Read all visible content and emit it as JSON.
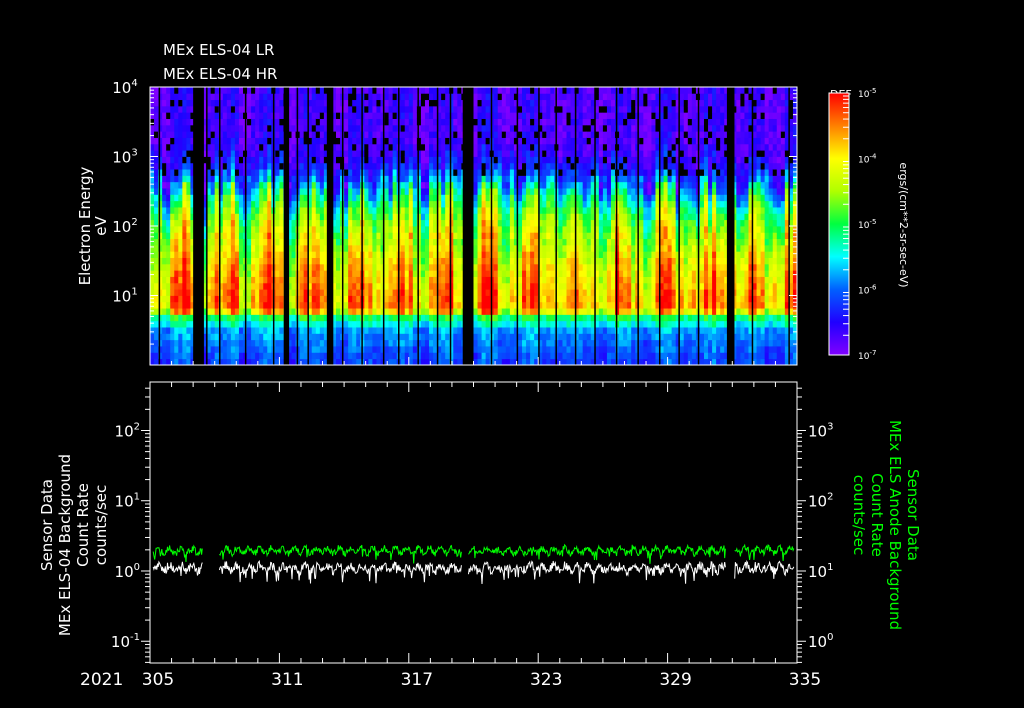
{
  "chart_data": [
    {
      "type": "heatmap",
      "title_lines": [
        "MEx ELS-04 LR",
        "MEx ELS-04 HR"
      ],
      "ylabel": [
        "Electron Energy",
        "eV"
      ],
      "yscale": "log",
      "ylim": [
        1,
        10000
      ],
      "yticks": [
        {
          "v": 10,
          "base": "10",
          "exp": "1"
        },
        {
          "v": 100,
          "base": "10",
          "exp": "2"
        },
        {
          "v": 1000,
          "base": "10",
          "exp": "3"
        },
        {
          "v": 10000,
          "base": "10",
          "exp": "4"
        }
      ],
      "xlim": [
        305,
        335
      ],
      "colorbar": {
        "label": "DEF",
        "units": "ergs/(cm**2-sr-sec-eV)",
        "log_range": [
          -7,
          -5
        ],
        "ticks": [
          {
            "base": "10",
            "exp": "-5",
            "v": -5
          },
          {
            "base": "10",
            "exp": "-4",
            "v": -4
          },
          {
            "base": "10",
            "exp": "-5",
            "v": -3
          },
          {
            "base": "10",
            "exp": "-6",
            "v": -2
          },
          {
            "base": "10",
            "exp": "-7",
            "v": -1
          }
        ],
        "colors": [
          "#8000ff",
          "#2000ff",
          "#0060ff",
          "#00ffff",
          "#00ff40",
          "#b0ff00",
          "#ffff00",
          "#ff8000",
          "#ff0000"
        ]
      },
      "typical_profile": {
        "log_energy_eV": [
          0.0,
          0.5,
          0.7,
          0.8,
          1.0,
          1.5,
          2.0,
          2.3,
          2.6,
          3.0,
          3.5,
          4.0
        ],
        "log_def": [
          -6.6,
          -6.4,
          -6.0,
          -5.3,
          -5.3,
          -5.5,
          -5.8,
          -6.1,
          -6.6,
          -6.85,
          -6.85,
          -6.85
        ]
      },
      "data_gaps_day": [
        [
          307.0,
          307.5
        ],
        [
          311.2,
          311.45
        ],
        [
          313.2,
          313.5
        ],
        [
          319.5,
          320.0
        ],
        [
          331.75,
          332.1
        ]
      ],
      "thin_gaps_day": [
        305.4,
        307.6,
        308.2,
        309.4,
        310.7,
        311.8,
        312.3,
        313.9,
        314.8,
        315.8,
        316.5,
        317.4,
        318.3,
        318.9,
        320.8,
        322.0,
        323.0,
        323.8,
        324.7,
        325.6,
        326.6,
        327.6,
        328.6,
        329.5,
        330.4,
        332.9,
        334.6
      ]
    },
    {
      "type": "line",
      "ylabel_left": [
        "MEx ELS-04 Background",
        "Count Rate",
        "counts/sec"
      ],
      "ylabel_left_top": "Sensor Data",
      "ylabel_right": [
        "MEx ELS Anode Background",
        "Count Rate",
        "counts/sec"
      ],
      "ylabel_right_top": "Sensor Data",
      "yscale": "log",
      "ylim_left": [
        0.049,
        490
      ],
      "ylim_right": [
        0.49,
        4900
      ],
      "yticks_left": [
        {
          "v": 0.1,
          "base": "10",
          "exp": "-1"
        },
        {
          "v": 1,
          "base": "10",
          "exp": "0"
        },
        {
          "v": 10,
          "base": "10",
          "exp": "1"
        },
        {
          "v": 100,
          "base": "10",
          "exp": "2"
        }
      ],
      "yticks_right": [
        {
          "v": 1,
          "base": "10",
          "exp": "0"
        },
        {
          "v": 10,
          "base": "10",
          "exp": "1"
        },
        {
          "v": 100,
          "base": "10",
          "exp": "2"
        },
        {
          "v": 1000,
          "base": "10",
          "exp": "3"
        }
      ],
      "xlim": [
        305,
        335
      ],
      "year": "2021",
      "xticks": [
        "305",
        "311",
        "317",
        "323",
        "329",
        "335"
      ],
      "data_gaps_day": [
        [
          307.45,
          308.2
        ],
        [
          319.45,
          319.75
        ],
        [
          331.7,
          332.1
        ]
      ],
      "series": [
        {
          "name": "MEx ELS-04 Background",
          "axis": "left",
          "color": "#ffffff",
          "mean": 1.1,
          "spread": 0.25
        },
        {
          "name": "MEx ELS Anode Background",
          "axis": "right",
          "color": "#00ff00",
          "mean": 19.5,
          "spread": 0.18
        }
      ]
    }
  ]
}
